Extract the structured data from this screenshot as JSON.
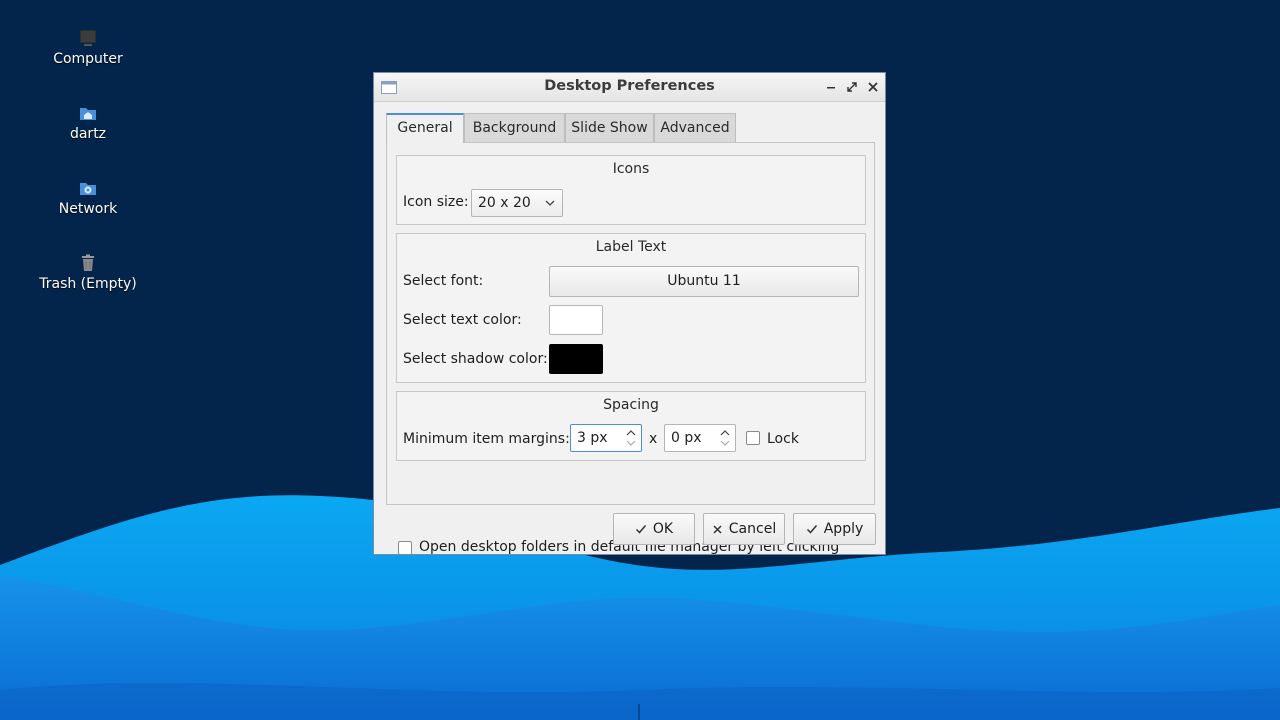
{
  "desktop": {
    "icons": [
      {
        "label": "Computer",
        "icon": "computer-icon"
      },
      {
        "label": "dartz",
        "icon": "home-folder-icon"
      },
      {
        "label": "Network",
        "icon": "network-folder-icon"
      },
      {
        "label": "Trash (Empty)",
        "icon": "trash-icon"
      }
    ]
  },
  "window": {
    "title": "Desktop Preferences",
    "controls": [
      "minimize-icon",
      "maximize-icon",
      "close-icon"
    ]
  },
  "tabs": [
    {
      "label": "General",
      "active": true
    },
    {
      "label": "Background",
      "active": false
    },
    {
      "label": "Slide Show",
      "active": false
    },
    {
      "label": "Advanced",
      "active": false
    }
  ],
  "general": {
    "icons_group": {
      "title": "Icons",
      "icon_size_label": "Icon size:",
      "icon_size_value": "20 x 20"
    },
    "label_text_group": {
      "title": "Label Text",
      "font_label": "Select font:",
      "font_value": "Ubuntu 11",
      "text_color_label": "Select text color:",
      "text_color": "#ffffff",
      "shadow_color_label": "Select shadow color:",
      "shadow_color": "#000000"
    },
    "spacing_group": {
      "title": "Spacing",
      "margins_label": "Minimum item margins:",
      "margin_x": "3 px",
      "separator": "x",
      "margin_y": "0 px",
      "lock_label": "Lock",
      "lock_checked": false
    },
    "open_folders_label": "Open desktop folders in default file manager by left clicking",
    "open_folders_checked": false
  },
  "buttons": {
    "ok": "OK",
    "cancel": "Cancel",
    "apply": "Apply"
  },
  "colors": {
    "desktop_bg": "#03254c",
    "wave_light": "#0aa0ee",
    "wave_dark": "#0068c8",
    "accent": "#4a8fd8"
  }
}
